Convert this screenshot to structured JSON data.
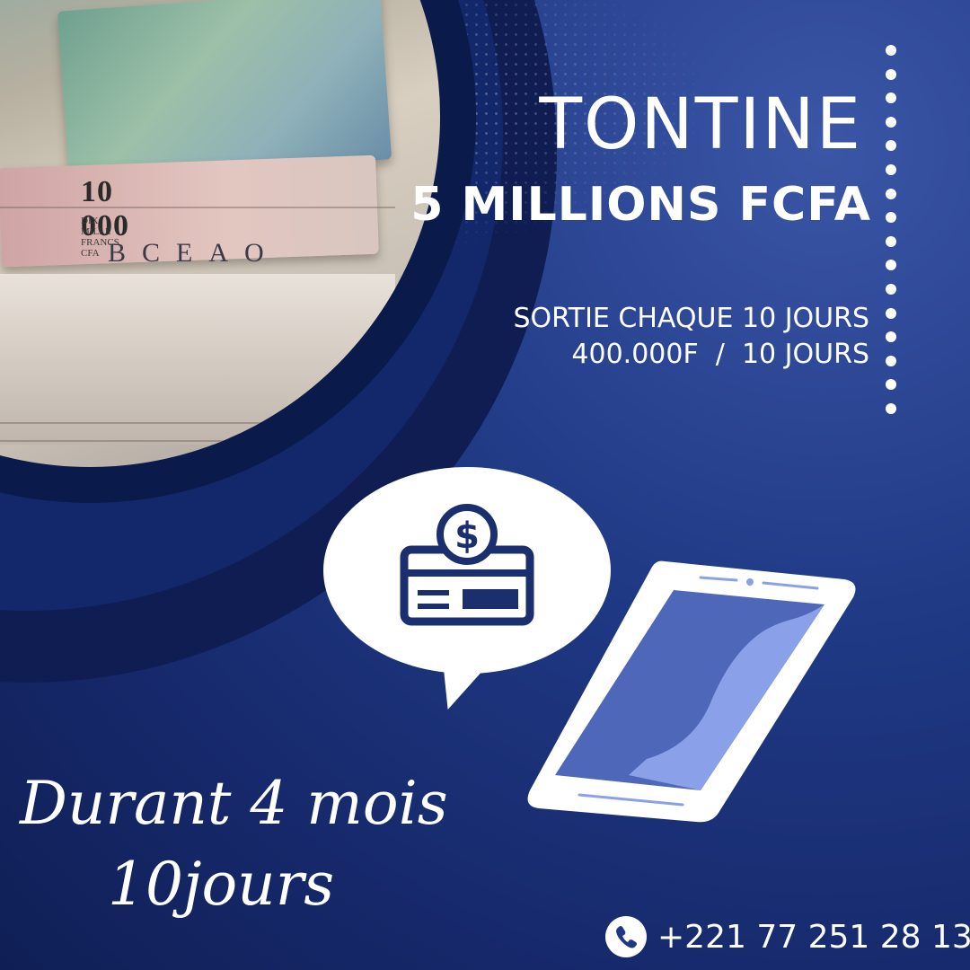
{
  "headline": {
    "title": "TONTINE",
    "amount": "5 MILLIONS FCFA"
  },
  "details": {
    "line1": "SORTIE CHAQUE 10 JOURS",
    "line2": "400.000F  /  10 JOURS"
  },
  "duration": {
    "line1": "Durant 4 mois",
    "line2": "10jours"
  },
  "contact": {
    "phone": "+221 77 251 28 13"
  },
  "banknote": {
    "amount": "10 000",
    "subtitle": "DIX MILLE FRANCS CFA",
    "bank": "BCEAO"
  },
  "icons": [
    "dollar-coin-icon",
    "credit-card-icon",
    "smartphone-icon",
    "phone-icon"
  ],
  "colors": {
    "background": "#1f3784",
    "dark_navy": "#0f1d52",
    "white": "#ffffff",
    "accent_blue": "#4f67b8",
    "light_blue": "#8aa1ea"
  }
}
